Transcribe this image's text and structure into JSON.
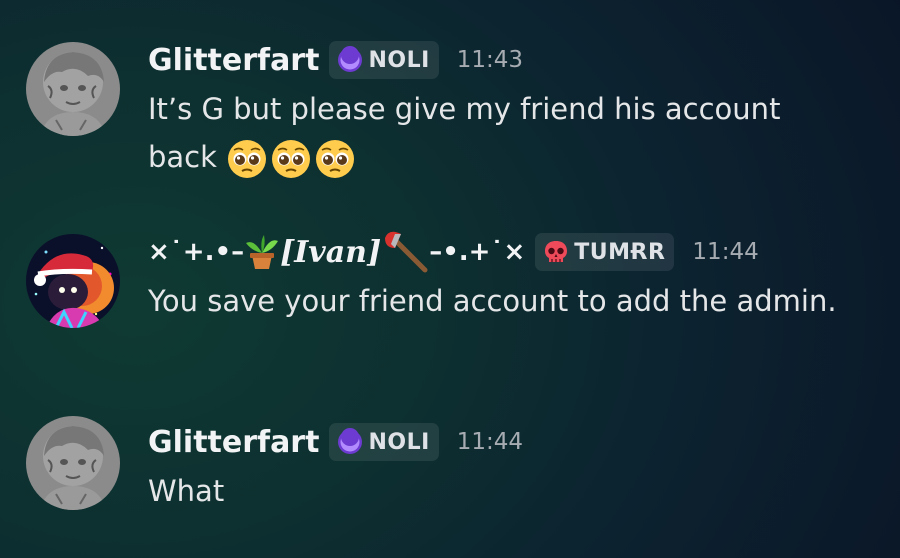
{
  "messages": [
    {
      "username": "Glitterfart",
      "tag": "NOLI",
      "tag_icon": "purple-crescent-icon",
      "time": "11:43",
      "text": "It’s G but please give my friend his account back",
      "emoji": [
        "pleading-face-icon",
        "pleading-face-icon",
        "pleading-face-icon"
      ]
    },
    {
      "username_prefix": "×˙+.•–",
      "username_name": "[Ivan]",
      "username_suffix": "–•.+˙×",
      "username_icons": [
        "potted-plant-icon",
        "axe-icon"
      ],
      "tag": "TUMɌR",
      "tag_icon": "red-skull-icon",
      "time": "11:44",
      "text": "You save your friend account to add the admin."
    },
    {
      "username": "Glitterfart",
      "tag": "NOLI",
      "tag_icon": "purple-crescent-icon",
      "time": "11:44",
      "text": "What"
    }
  ],
  "colors": {
    "background": "#0c2330",
    "username": "#f2f3f5",
    "timestamp": "#a7acb2",
    "tag_bg": "#ffffff17",
    "noli_icon": "#9b5cf6",
    "tumor_icon": "#ef4a5a"
  }
}
